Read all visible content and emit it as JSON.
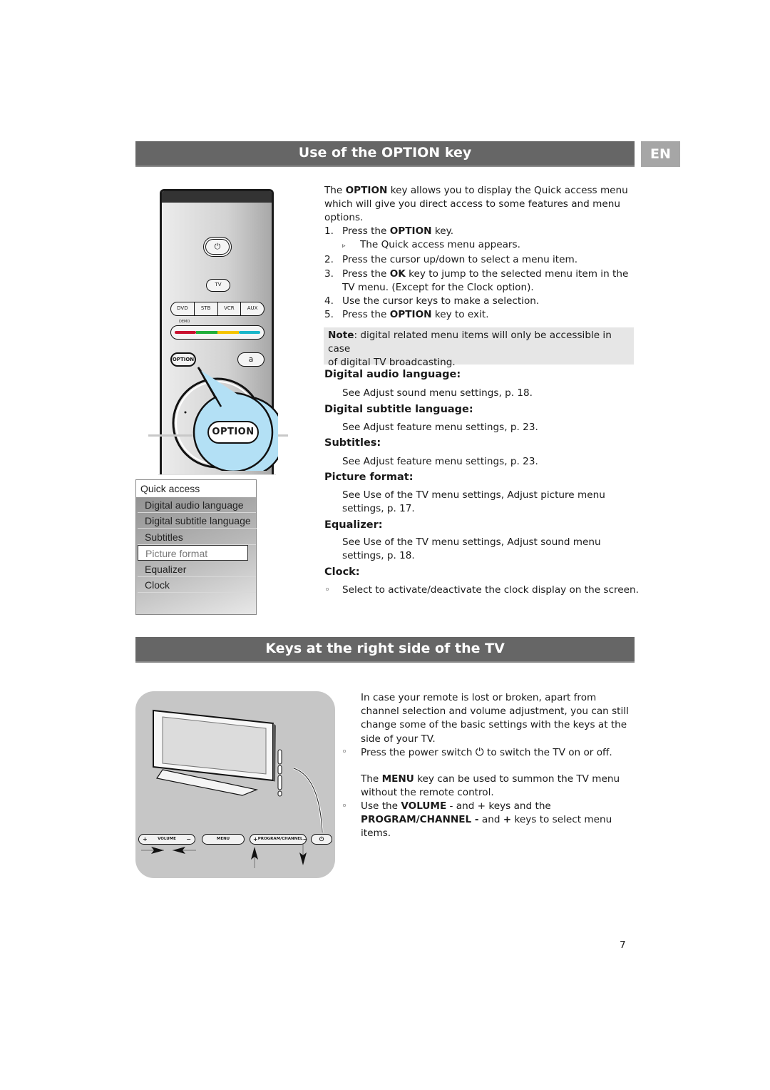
{
  "header": {
    "section1_title": "Use of the OPTION key",
    "language_tab": "EN",
    "section2_title": "Keys at the right side of the TV"
  },
  "remote": {
    "power_icon": "power-icon",
    "tv_label": "TV",
    "source_keys": [
      "DVD",
      "STB",
      "VCR",
      "AUX"
    ],
    "demo_label": "DEMO",
    "color_keys": [
      "#c8102e",
      "#1fae3a",
      "#f5c400",
      "#19b6c9"
    ],
    "option_label": "OPTION",
    "a_label": "a",
    "callout_label": "OPTION",
    "callout_color": "#b3e0f5"
  },
  "quick_menu": {
    "title": "Quick access",
    "items": [
      {
        "label": "Digital audio language"
      },
      {
        "label": "Digital subtitle language"
      },
      {
        "label": "Subtitles"
      },
      {
        "label": "Picture format",
        "selected": true
      },
      {
        "label": "Equalizer"
      },
      {
        "label": "Clock"
      }
    ]
  },
  "intro": {
    "p1_a": "The ",
    "p1_b": "OPTION",
    "p1_c": " key allows you to display the Quick access menu",
    "p1_line2": "which will give you direct access to some features and menu",
    "p1_line3": "options.",
    "steps": [
      {
        "num": "1.",
        "a": "Press the ",
        "b": "OPTION",
        "c": " key."
      },
      {
        "num": "▹",
        "a": "The Quick access menu appears.",
        "b": "",
        "c": ""
      },
      {
        "num": "2.",
        "a": "Press the cursor up/down to select a menu item.",
        "b": "",
        "c": ""
      },
      {
        "num": "3.",
        "a": "Press the ",
        "b": "OK",
        "c": " key to jump to the selected menu item in the"
      },
      {
        "num": "",
        "a": "TV menu. (Except for the Clock option).",
        "b": "",
        "c": ""
      },
      {
        "num": "4.",
        "a": "Use the cursor keys to make a selection.",
        "b": "",
        "c": ""
      },
      {
        "num": "5.",
        "a": "Press the ",
        "b": "OPTION",
        "c": " key to exit."
      }
    ]
  },
  "note": {
    "label": "Note",
    "line1": ": digital related menu items will only be accessible in case",
    "line2": "of digital TV broadcasting."
  },
  "options": [
    {
      "title": "Digital audio language:",
      "lines": [
        "See Adjust sound menu settings, p. 18."
      ]
    },
    {
      "title": "Digital subtitle language:",
      "lines": [
        "See Adjust feature menu settings, p. 23."
      ]
    },
    {
      "title": "Subtitles:",
      "lines": [
        "See Adjust feature menu settings, p. 23."
      ]
    },
    {
      "title": "Picture format:",
      "lines": [
        "See Use of the TV menu settings, Adjust picture menu",
        "settings, p. 17."
      ]
    },
    {
      "title": "Equalizer:",
      "lines": [
        "See Use of the TV menu settings, Adjust sound menu",
        "settings, p. 18."
      ]
    },
    {
      "title": "Clock:",
      "bullet": "◦",
      "lines": [
        "Select to activate/deactivate the clock display on the screen."
      ]
    }
  ],
  "tv_keys": {
    "volume_label": "VOLUME",
    "menu_label": "MENU",
    "program_label": "PROGRAM/CHANNEL",
    "plus": "+",
    "minus": "−"
  },
  "section2_text": {
    "p1": [
      "In case your remote is lost or broken, apart from",
      "channel selection and volume adjustment, you can still",
      "change some of the basic settings with the keys at the",
      "side of your TV."
    ],
    "bullet1_a": "Press the power switch",
    "bullet1_b": "to switch the TV on or off.",
    "p2_a": "The ",
    "p2_b": "MENU",
    "p2_c": " key can be used to summon the TV menu",
    "p2_line2": "without the remote control.",
    "bullet2_a": "Use the ",
    "bullet2_b": "VOLUME",
    "bullet2_c": " - and + keys and the",
    "bullet2_line2_b": "PROGRAM/CHANNEL -",
    "bullet2_line2_c": " and ",
    "bullet2_line2_d": "+",
    "bullet2_line2_e": "  keys to select menu",
    "bullet2_line3": "items.",
    "bullet": "◦"
  },
  "page_number": "7"
}
